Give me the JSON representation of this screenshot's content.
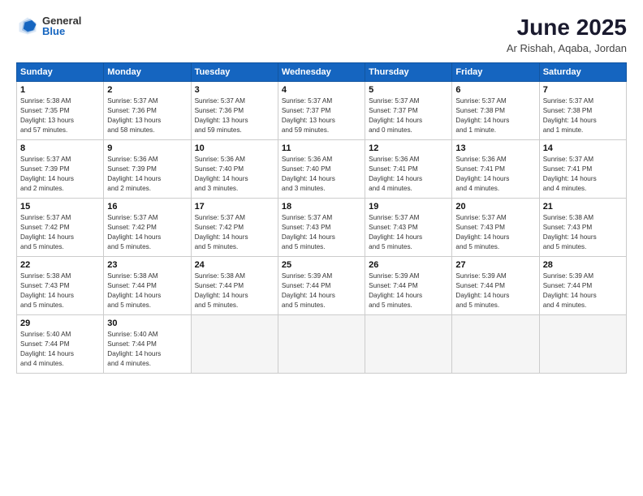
{
  "header": {
    "logo_general": "General",
    "logo_blue": "Blue",
    "month_title": "June 2025",
    "location": "Ar Rishah, Aqaba, Jordan"
  },
  "days_of_week": [
    "Sunday",
    "Monday",
    "Tuesday",
    "Wednesday",
    "Thursday",
    "Friday",
    "Saturday"
  ],
  "weeks": [
    [
      {
        "day": 1,
        "info": "Sunrise: 5:38 AM\nSunset: 7:35 PM\nDaylight: 13 hours\nand 57 minutes."
      },
      {
        "day": 2,
        "info": "Sunrise: 5:37 AM\nSunset: 7:36 PM\nDaylight: 13 hours\nand 58 minutes."
      },
      {
        "day": 3,
        "info": "Sunrise: 5:37 AM\nSunset: 7:36 PM\nDaylight: 13 hours\nand 59 minutes."
      },
      {
        "day": 4,
        "info": "Sunrise: 5:37 AM\nSunset: 7:37 PM\nDaylight: 13 hours\nand 59 minutes."
      },
      {
        "day": 5,
        "info": "Sunrise: 5:37 AM\nSunset: 7:37 PM\nDaylight: 14 hours\nand 0 minutes."
      },
      {
        "day": 6,
        "info": "Sunrise: 5:37 AM\nSunset: 7:38 PM\nDaylight: 14 hours\nand 1 minute."
      },
      {
        "day": 7,
        "info": "Sunrise: 5:37 AM\nSunset: 7:38 PM\nDaylight: 14 hours\nand 1 minute."
      }
    ],
    [
      {
        "day": 8,
        "info": "Sunrise: 5:37 AM\nSunset: 7:39 PM\nDaylight: 14 hours\nand 2 minutes."
      },
      {
        "day": 9,
        "info": "Sunrise: 5:36 AM\nSunset: 7:39 PM\nDaylight: 14 hours\nand 2 minutes."
      },
      {
        "day": 10,
        "info": "Sunrise: 5:36 AM\nSunset: 7:40 PM\nDaylight: 14 hours\nand 3 minutes."
      },
      {
        "day": 11,
        "info": "Sunrise: 5:36 AM\nSunset: 7:40 PM\nDaylight: 14 hours\nand 3 minutes."
      },
      {
        "day": 12,
        "info": "Sunrise: 5:36 AM\nSunset: 7:41 PM\nDaylight: 14 hours\nand 4 minutes."
      },
      {
        "day": 13,
        "info": "Sunrise: 5:36 AM\nSunset: 7:41 PM\nDaylight: 14 hours\nand 4 minutes."
      },
      {
        "day": 14,
        "info": "Sunrise: 5:37 AM\nSunset: 7:41 PM\nDaylight: 14 hours\nand 4 minutes."
      }
    ],
    [
      {
        "day": 15,
        "info": "Sunrise: 5:37 AM\nSunset: 7:42 PM\nDaylight: 14 hours\nand 5 minutes."
      },
      {
        "day": 16,
        "info": "Sunrise: 5:37 AM\nSunset: 7:42 PM\nDaylight: 14 hours\nand 5 minutes."
      },
      {
        "day": 17,
        "info": "Sunrise: 5:37 AM\nSunset: 7:42 PM\nDaylight: 14 hours\nand 5 minutes."
      },
      {
        "day": 18,
        "info": "Sunrise: 5:37 AM\nSunset: 7:43 PM\nDaylight: 14 hours\nand 5 minutes."
      },
      {
        "day": 19,
        "info": "Sunrise: 5:37 AM\nSunset: 7:43 PM\nDaylight: 14 hours\nand 5 minutes."
      },
      {
        "day": 20,
        "info": "Sunrise: 5:37 AM\nSunset: 7:43 PM\nDaylight: 14 hours\nand 5 minutes."
      },
      {
        "day": 21,
        "info": "Sunrise: 5:38 AM\nSunset: 7:43 PM\nDaylight: 14 hours\nand 5 minutes."
      }
    ],
    [
      {
        "day": 22,
        "info": "Sunrise: 5:38 AM\nSunset: 7:43 PM\nDaylight: 14 hours\nand 5 minutes."
      },
      {
        "day": 23,
        "info": "Sunrise: 5:38 AM\nSunset: 7:44 PM\nDaylight: 14 hours\nand 5 minutes."
      },
      {
        "day": 24,
        "info": "Sunrise: 5:38 AM\nSunset: 7:44 PM\nDaylight: 14 hours\nand 5 minutes."
      },
      {
        "day": 25,
        "info": "Sunrise: 5:39 AM\nSunset: 7:44 PM\nDaylight: 14 hours\nand 5 minutes."
      },
      {
        "day": 26,
        "info": "Sunrise: 5:39 AM\nSunset: 7:44 PM\nDaylight: 14 hours\nand 5 minutes."
      },
      {
        "day": 27,
        "info": "Sunrise: 5:39 AM\nSunset: 7:44 PM\nDaylight: 14 hours\nand 5 minutes."
      },
      {
        "day": 28,
        "info": "Sunrise: 5:39 AM\nSunset: 7:44 PM\nDaylight: 14 hours\nand 4 minutes."
      }
    ],
    [
      {
        "day": 29,
        "info": "Sunrise: 5:40 AM\nSunset: 7:44 PM\nDaylight: 14 hours\nand 4 minutes."
      },
      {
        "day": 30,
        "info": "Sunrise: 5:40 AM\nSunset: 7:44 PM\nDaylight: 14 hours\nand 4 minutes."
      },
      null,
      null,
      null,
      null,
      null
    ]
  ]
}
